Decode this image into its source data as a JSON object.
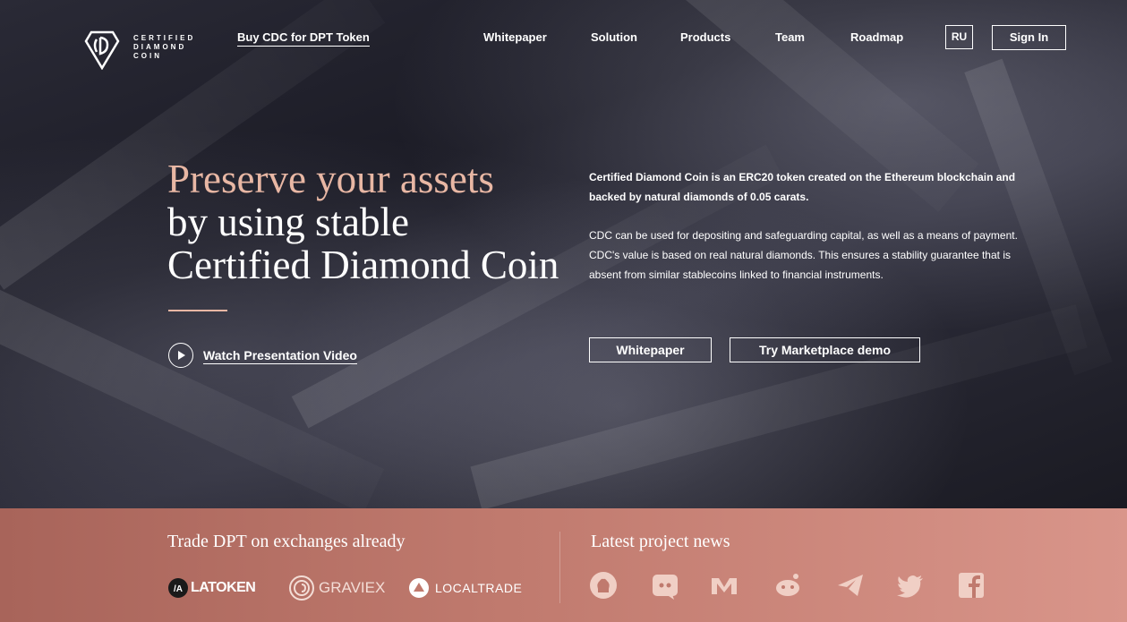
{
  "nav": {
    "logo_text": [
      "CERTIFIED",
      "DIAMOND",
      "COIN"
    ],
    "buy_link": "Buy CDC for DPT Token",
    "items": [
      "Whitepaper",
      "Solution",
      "Products",
      "Team",
      "Roadmap"
    ],
    "lang": "RU",
    "sign_in": "Sign In"
  },
  "hero": {
    "headline_line1_a": "Preserve your ",
    "headline_line1_b": "assets",
    "headline_line2": "by using stable",
    "headline_line3": "Certified Diamond Coin",
    "watch_video": "Watch Presentation Video",
    "desc_bold": "Certified Diamond Coin is an ERC20 token created on the Ethereum blockchain and backed by natural diamonds of 0.05 carats.",
    "desc": "CDC can be used for depositing and safeguarding capital, as well as a means of payment. CDC's value is based on real natural diamonds. This ensures a stability guarantee that is absent from similar stablecoins linked to financial instruments.",
    "cta_whitepaper": "Whitepaper",
    "cta_marketplace": "Try Marketplace demo"
  },
  "exchanges": {
    "title": "Trade DPT on exchanges already",
    "items": [
      "LATOKEN",
      "GRAVIEX",
      "LOCALTRADE"
    ]
  },
  "news": {
    "title": "Latest project news",
    "icons": [
      "github-icon",
      "discord-icon",
      "medium-icon",
      "reddit-icon",
      "telegram-icon",
      "twitter-icon",
      "facebook-icon"
    ]
  },
  "colors": {
    "accent": "#e8b7a4",
    "bottom_start": "#a8645a",
    "bottom_end": "#d9958a"
  }
}
